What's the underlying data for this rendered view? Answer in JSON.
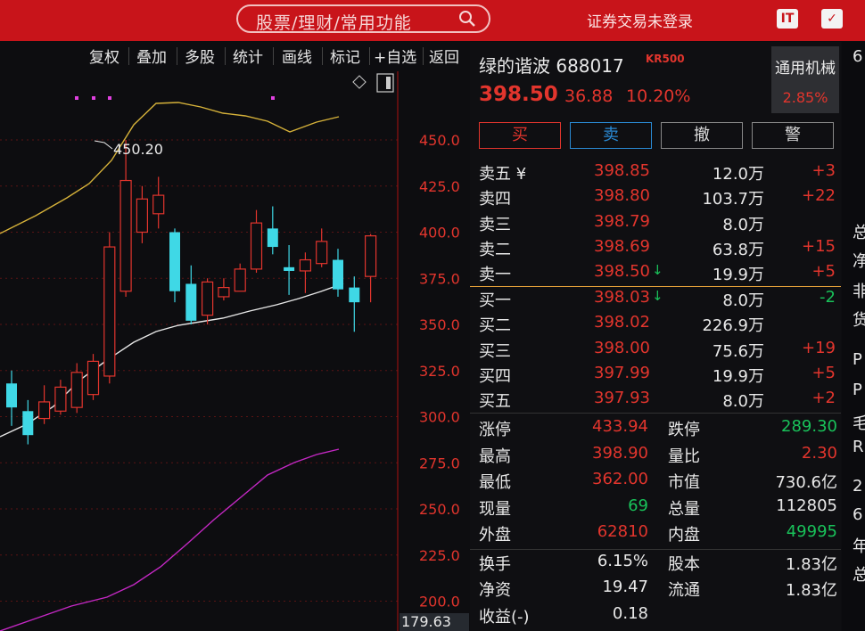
{
  "topbar": {
    "search_placeholder": "股票/理财/常用功能",
    "login_status": "证券交易未登录",
    "btn1": "IT",
    "btn2": "✓"
  },
  "toolbar": {
    "items": [
      "复权",
      "叠加",
      "多股",
      "统计",
      "画线",
      "标记",
      "+自选",
      "返回"
    ]
  },
  "chart": {
    "high_marker": "450.20",
    "y_labels": [
      "450.0",
      "425.0",
      "400.0",
      "375.0",
      "350.0",
      "325.0",
      "300.0",
      "275.0",
      "250.0",
      "225.0",
      "200.0"
    ],
    "bottom_price": "179.63",
    "up_color": "#e2352d",
    "down_color": "#3fd8e6",
    "candles": [
      {
        "o": 318,
        "h": 325,
        "l": 295,
        "c": 305
      },
      {
        "o": 303,
        "h": 309,
        "l": 285,
        "c": 290
      },
      {
        "o": 299,
        "h": 317,
        "l": 296,
        "c": 308
      },
      {
        "o": 303,
        "h": 320,
        "l": 301,
        "c": 316
      },
      {
        "o": 305,
        "h": 329,
        "l": 302,
        "c": 324
      },
      {
        "o": 312,
        "h": 334,
        "l": 309,
        "c": 330
      },
      {
        "o": 322,
        "h": 400,
        "l": 318,
        "c": 392
      },
      {
        "o": 368,
        "h": 450,
        "l": 365,
        "c": 428
      },
      {
        "o": 400,
        "h": 425,
        "l": 394,
        "c": 418
      },
      {
        "o": 410,
        "h": 430,
        "l": 402,
        "c": 420
      },
      {
        "o": 400,
        "h": 402,
        "l": 362,
        "c": 368
      },
      {
        "o": 372,
        "h": 382,
        "l": 350,
        "c": 352
      },
      {
        "o": 355,
        "h": 375,
        "l": 350,
        "c": 373
      },
      {
        "o": 365,
        "h": 375,
        "l": 363,
        "c": 370
      },
      {
        "o": 368,
        "h": 383,
        "l": 368,
        "c": 380
      },
      {
        "o": 380,
        "h": 412,
        "l": 378,
        "c": 405
      },
      {
        "o": 402,
        "h": 414,
        "l": 388,
        "c": 392
      },
      {
        "o": 381,
        "h": 393,
        "l": 366,
        "c": 379
      },
      {
        "o": 379,
        "h": 389,
        "l": 367,
        "c": 385
      },
      {
        "o": 383,
        "h": 402,
        "l": 381,
        "c": 395
      },
      {
        "o": 385,
        "h": 391,
        "l": 365,
        "c": 369
      },
      {
        "o": 370,
        "h": 376,
        "l": 346,
        "c": 362
      },
      {
        "o": 376,
        "h": 399,
        "l": 362,
        "c": 398
      }
    ]
  },
  "stock": {
    "name_code": "绿的谐波 688017",
    "tag": "KR500",
    "price": "398.50",
    "change": "36.88",
    "change_pct": "10.20%",
    "sector": "通用机械",
    "sector_pct": "2.85%"
  },
  "actions": [
    "买",
    "卖",
    "撤",
    "警"
  ],
  "asks": [
    {
      "label": "卖五 ¥",
      "price": "398.85",
      "vol": "12.0万",
      "chg": "+3",
      "arrow": ""
    },
    {
      "label": "卖四",
      "price": "398.80",
      "vol": "103.7万",
      "chg": "+22",
      "arrow": ""
    },
    {
      "label": "卖三",
      "price": "398.79",
      "vol": "8.0万",
      "chg": "",
      "arrow": ""
    },
    {
      "label": "卖二",
      "price": "398.69",
      "vol": "63.8万",
      "chg": "+15",
      "arrow": ""
    },
    {
      "label": "卖一",
      "price": "398.50",
      "vol": "19.9万",
      "chg": "+5",
      "arrow": "🡣"
    }
  ],
  "bids": [
    {
      "label": "买一",
      "price": "398.03",
      "vol": "8.0万",
      "chg": "-2",
      "arrow": "🡣"
    },
    {
      "label": "买二",
      "price": "398.02",
      "vol": "226.9万",
      "chg": "",
      "arrow": ""
    },
    {
      "label": "买三",
      "price": "398.00",
      "vol": "75.6万",
      "chg": "+19",
      "arrow": ""
    },
    {
      "label": "买四",
      "price": "397.99",
      "vol": "19.9万",
      "chg": "+5",
      "arrow": ""
    },
    {
      "label": "买五",
      "price": "397.93",
      "vol": "8.0万",
      "chg": "+2",
      "arrow": ""
    }
  ],
  "quote": [
    {
      "l1": "涨停",
      "v1": "433.94",
      "c1": "red",
      "l2": "跌停",
      "v2": "289.30",
      "c2": "green"
    },
    {
      "l1": "最高",
      "v1": "398.90",
      "c1": "red",
      "l2": "量比",
      "v2": "2.30",
      "c2": "red"
    },
    {
      "l1": "最低",
      "v1": "362.00",
      "c1": "red",
      "l2": "市值",
      "v2": "730.6亿",
      "c2": "white"
    },
    {
      "l1": "现量",
      "v1": "69",
      "c1": "green",
      "l2": "总量",
      "v2": "112805",
      "c2": "white"
    },
    {
      "l1": "外盘",
      "v1": "62810",
      "c1": "red",
      "l2": "内盘",
      "v2": "49995",
      "c2": "green"
    },
    {
      "l1": "换手",
      "v1": "6.15%",
      "c1": "white",
      "l2": "股本",
      "v2": "1.83亿",
      "c2": "white"
    },
    {
      "l1": "净资",
      "v1": "19.47",
      "c1": "white",
      "l2": "流通",
      "v2": "1.83亿",
      "c2": "white"
    },
    {
      "l1": "收益(-)",
      "v1": "0.18",
      "c1": "white",
      "l2": "",
      "v2": "",
      "c2": "white"
    }
  ],
  "edge_chars": [
    "6",
    "总",
    "净",
    "非",
    "货",
    "P",
    "P",
    "毛",
    "R",
    "2",
    "6",
    "年",
    "总"
  ]
}
